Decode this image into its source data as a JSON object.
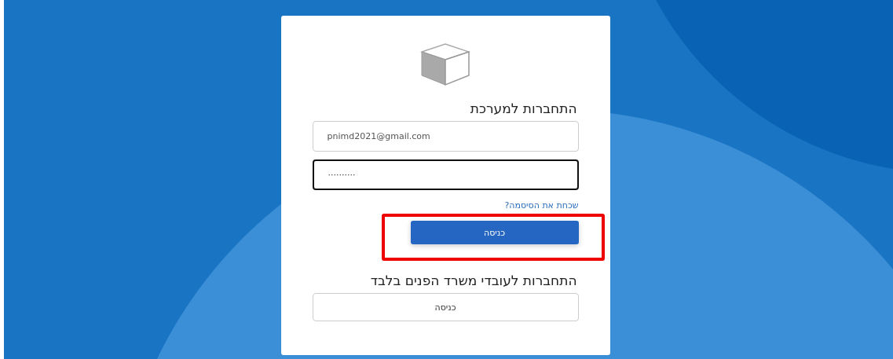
{
  "login": {
    "title": "התחברות למערכת",
    "email": {
      "value": "pnimd2021@gmail.com"
    },
    "password": {
      "value": "··········",
      "focused": true
    },
    "forgot_link": "שכחת את הסיסמה?",
    "submit": {
      "label": "כניסה",
      "highlighted": true
    }
  },
  "employees": {
    "title": "התחברות לעובדי משרד הפנים בלבד",
    "button": {
      "label": "כניסה"
    }
  }
}
